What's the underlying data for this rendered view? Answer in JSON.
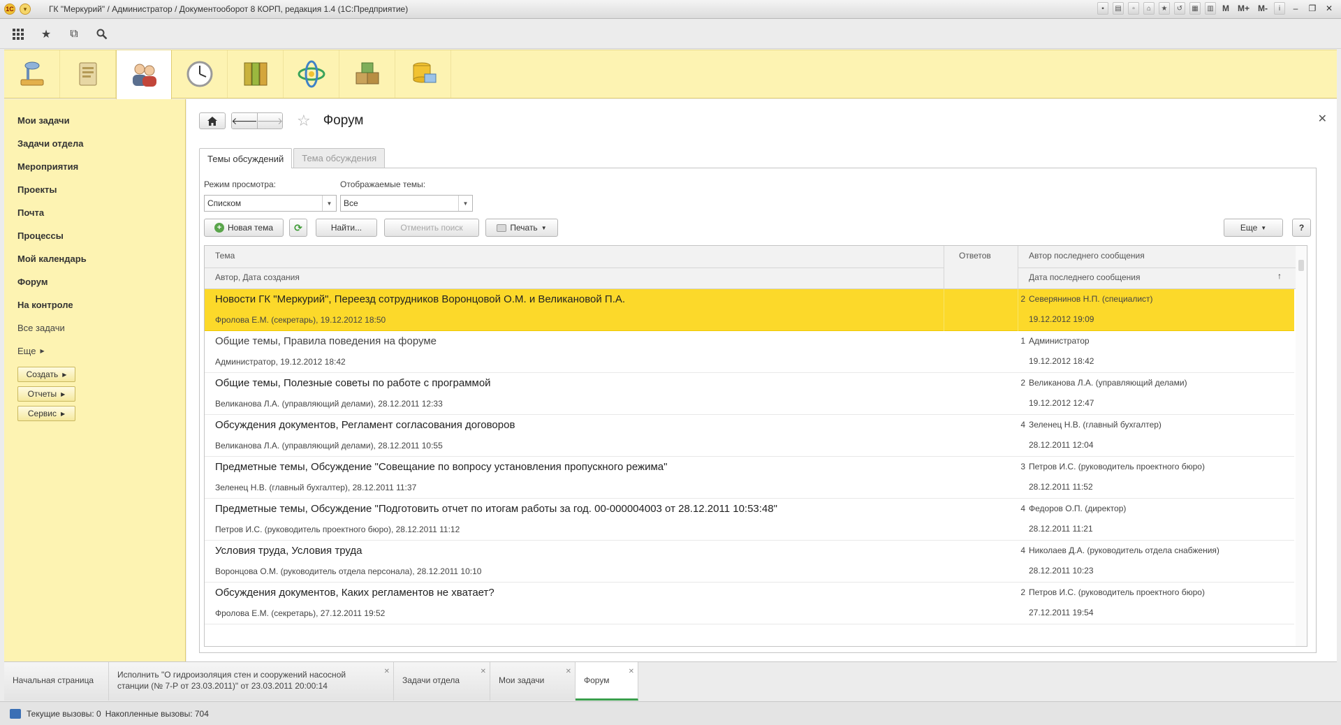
{
  "window": {
    "title": "ГК \"Меркурий\" / Администратор / Документооборот 8 КОРП, редакция 1.4  (1С:Предприятие)",
    "right_tools": [
      "M",
      "M+",
      "M-"
    ]
  },
  "quickbar": {
    "icons": [
      "apps-grid-icon",
      "favorites-star-icon",
      "history-icon",
      "search-icon"
    ]
  },
  "sections": [
    {
      "name": "desk-lamp-section",
      "active": false
    },
    {
      "name": "documents-section",
      "active": false
    },
    {
      "name": "users-section",
      "active": true
    },
    {
      "name": "clock-section",
      "active": false
    },
    {
      "name": "folders-section",
      "active": false
    },
    {
      "name": "processes-section",
      "active": false
    },
    {
      "name": "warehouse-section",
      "active": false
    },
    {
      "name": "database-section",
      "active": false
    }
  ],
  "leftnav": {
    "items": [
      {
        "label": "Мои задачи",
        "bold": true
      },
      {
        "label": "Задачи отдела",
        "bold": true
      },
      {
        "label": "Мероприятия",
        "bold": true
      },
      {
        "label": "Проекты",
        "bold": true
      },
      {
        "label": "Почта",
        "bold": true
      },
      {
        "label": "Процессы",
        "bold": true
      },
      {
        "label": "Мой календарь",
        "bold": true
      },
      {
        "label": "Форум",
        "bold": true
      },
      {
        "label": "На контроле",
        "bold": true
      },
      {
        "label": "Все задачи",
        "bold": false
      }
    ],
    "more_label": "Еще",
    "buttons": [
      "Создать",
      "Отчеты",
      "Сервис"
    ]
  },
  "page": {
    "title": "Форум",
    "tabs": [
      {
        "label": "Темы обсуждений",
        "active": true
      },
      {
        "label": "Тема обсуждения",
        "active": false
      }
    ]
  },
  "filters": {
    "view_mode_label": "Режим просмотра:",
    "view_mode_value": "Списком",
    "topics_label": "Отображаемые темы:",
    "topics_value": "Все"
  },
  "commands": {
    "new_topic": "Новая тема",
    "find": "Найти...",
    "cancel_search": "Отменить поиск",
    "print": "Печать",
    "more": "Еще",
    "help": "?"
  },
  "table": {
    "headers": {
      "topic": "Тема",
      "author_date": "Автор, Дата создания",
      "replies": "Ответов",
      "last_author": "Автор последнего сообщения",
      "last_date": "Дата последнего сообщения"
    },
    "rows": [
      {
        "title": "Новости ГК \"Меркурий\", Переезд сотрудников Воронцовой О.М. и Великановой П.А.",
        "author": "Фролова Е.М. (секретарь), 19.12.2012 18:50",
        "replies": "2",
        "last_author": "Северянинов Н.П. (специалист)",
        "last_date": "19.12.2012 19:09",
        "selected": true,
        "unread": true
      },
      {
        "title": "Общие темы, Правила поведения на форуме",
        "author": "Администратор, 19.12.2012 18:42",
        "replies": "1",
        "last_author": "Администратор",
        "last_date": "19.12.2012 18:42",
        "selected": false,
        "unread": false
      },
      {
        "title": "Общие темы, Полезные советы по работе с программой",
        "author": "Великанова Л.А. (управляющий делами), 28.12.2011 12:33",
        "replies": "2",
        "last_author": "Великанова Л.А. (управляющий делами)",
        "last_date": "19.12.2012 12:47",
        "selected": false,
        "unread": true
      },
      {
        "title": "Обсуждения документов, Регламент согласования договоров",
        "author": "Великанова Л.А. (управляющий делами), 28.12.2011 10:55",
        "replies": "4",
        "last_author": "Зеленец Н.В. (главный бухгалтер)",
        "last_date": "28.12.2011 12:04",
        "selected": false,
        "unread": true
      },
      {
        "title": "Предметные темы, Обсуждение \"Совещание по вопросу установления пропускного режима\"",
        "author": "Зеленец Н.В. (главный бухгалтер), 28.12.2011 11:37",
        "replies": "3",
        "last_author": "Петров И.С. (руководитель проектного бюро)",
        "last_date": "28.12.2011 11:52",
        "selected": false,
        "unread": true
      },
      {
        "title": "Предметные темы, Обсуждение \"Подготовить отчет по итогам работы за год. 00-000004003 от 28.12.2011 10:53:48\"",
        "author": "Петров И.С. (руководитель проектного бюро), 28.12.2011 11:12",
        "replies": "4",
        "last_author": "Федоров О.П. (директор)",
        "last_date": "28.12.2011 11:21",
        "selected": false,
        "unread": true
      },
      {
        "title": "Условия труда, Условия труда",
        "author": "Воронцова О.М. (руководитель отдела персонала), 28.12.2011 10:10",
        "replies": "4",
        "last_author": "Николаев Д.А. (руководитель отдела снабжения)",
        "last_date": "28.12.2011 10:23",
        "selected": false,
        "unread": true
      },
      {
        "title": "Обсуждения документов, Каких регламентов не хватает?",
        "author": "Фролова Е.М. (секретарь), 27.12.2011 19:52",
        "replies": "2",
        "last_author": "Петров И.С. (руководитель проектного бюро)",
        "last_date": "27.12.2011 19:54",
        "selected": false,
        "unread": true
      }
    ]
  },
  "open_windows": [
    {
      "label": "Начальная страница",
      "closable": false,
      "active": false
    },
    {
      "label": "Исполнить \"О гидроизоляция стен и сооружений насосной станции (№ 7-Р от 23.03.2011)\" от 23.03.2011 20:00:14",
      "closable": true,
      "active": false
    },
    {
      "label": "Задачи отдела",
      "closable": true,
      "active": false
    },
    {
      "label": "Мои задачи",
      "closable": true,
      "active": false
    },
    {
      "label": "Форум",
      "closable": true,
      "active": true
    }
  ],
  "status": {
    "current_calls": "Текущие вызовы: 0",
    "accumulated_calls": "Накопленные вызовы: 704"
  },
  "colors": {
    "accent_yellow": "#fcd92a",
    "panel_yellow": "#fdf3b2",
    "active_tab_green": "#3a9f4c"
  }
}
